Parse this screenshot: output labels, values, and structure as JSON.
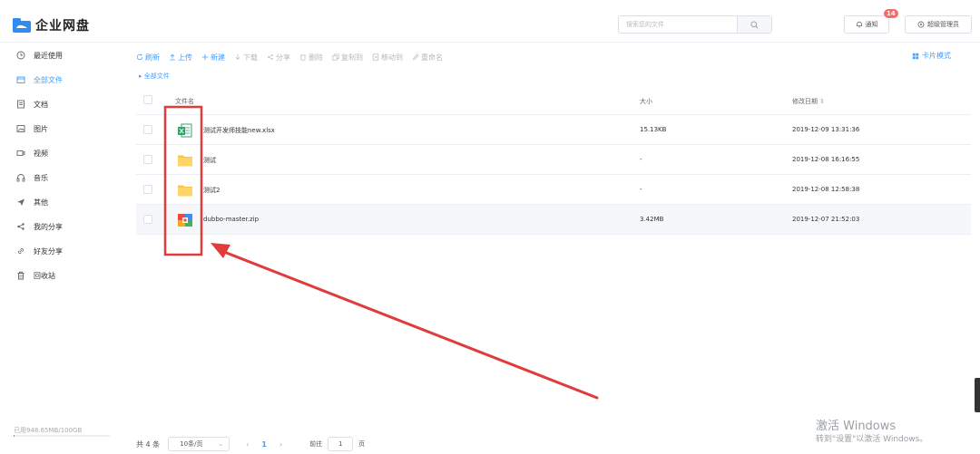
{
  "header": {
    "app_title": "企业网盘",
    "search_placeholder": "搜索您的文件",
    "notify_label": "通知",
    "notify_count": "14",
    "user_label": "超级管理员"
  },
  "sidebar": {
    "items": [
      {
        "label": "最近使用",
        "icon": "clock-icon"
      },
      {
        "label": "全部文件",
        "icon": "folder-icon",
        "active": true
      },
      {
        "label": "文档",
        "icon": "document-icon"
      },
      {
        "label": "图片",
        "icon": "image-icon"
      },
      {
        "label": "视频",
        "icon": "video-icon"
      },
      {
        "label": "音乐",
        "icon": "headphones-icon"
      },
      {
        "label": "其他",
        "icon": "send-icon"
      },
      {
        "label": "我的分享",
        "icon": "share-icon"
      },
      {
        "label": "好友分享",
        "icon": "link-icon"
      },
      {
        "label": "回收站",
        "icon": "trash-icon"
      }
    ],
    "usage_text": "已用948.65MB/100GB",
    "usage_fraction": 0.009
  },
  "toolbar": {
    "refresh": "刷新",
    "upload": "上传",
    "new": "新建",
    "download": "下载",
    "share": "分享",
    "delete": "删除",
    "copy_to": "复制到",
    "move_to": "移动到",
    "rename": "重命名",
    "card_mode": "卡片模式"
  },
  "breadcrumb": {
    "current": "全部文件"
  },
  "table": {
    "columns": {
      "name": "文件名",
      "size": "大小",
      "modified": "修改日期"
    },
    "rows": [
      {
        "name": "测试开发师技能new.xlsx",
        "size": "15.13KB",
        "modified": "2019-12-09 13:31:36",
        "icon": "excel-file-icon"
      },
      {
        "name": "测试",
        "size": "-",
        "modified": "2019-12-08 16:16:55",
        "icon": "folder-icon"
      },
      {
        "name": "测试2",
        "size": "-",
        "modified": "2019-12-08 12:58:38",
        "icon": "folder-icon"
      },
      {
        "name": "dubbo-master.zip",
        "size": "3.42MB",
        "modified": "2019-12-07 21:52:03",
        "icon": "zip-file-icon"
      }
    ]
  },
  "pagination": {
    "total": "共 4 条",
    "page_size": "10条/页",
    "prev": "‹",
    "current_page": "1",
    "next": "›",
    "goto_label": "前往",
    "goto_value": "1",
    "page_unit": "页"
  },
  "watermark": {
    "line1": "激活 Windows",
    "line2": "转到\"设置\"以激活 Windows。"
  },
  "colors": {
    "accent": "#409eff",
    "badge": "#f56c6c",
    "annotation": "#e03c3c",
    "folder": "#fcc44d"
  }
}
